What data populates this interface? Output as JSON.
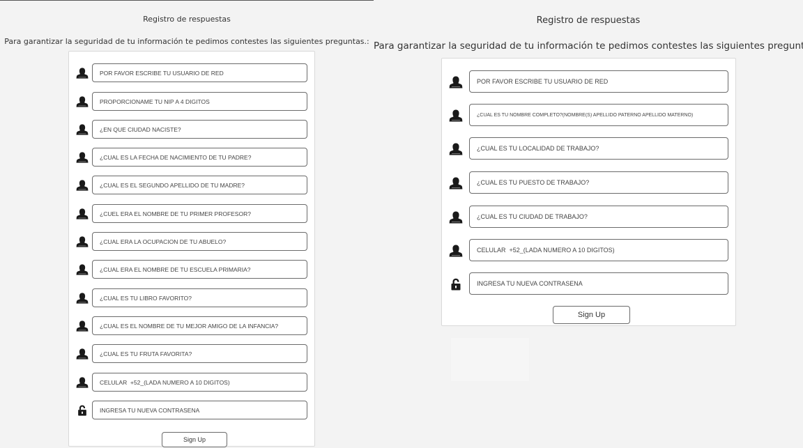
{
  "left_form": {
    "title": "Registro de respuestas",
    "subtitle": "Para garantizar la seguridad de tu información te pedimos contestes las siguientes preguntas.:",
    "fields": [
      {
        "placeholder": "POR FAVOR ESCRIBE TU USUARIO DE RED",
        "icon": "user-icon"
      },
      {
        "placeholder": "PROPORCIONAME TU NIP A 4 DIGITOS",
        "icon": "user-icon"
      },
      {
        "placeholder": "¿EN QUE CIUDAD NACISTE?",
        "icon": "user-icon"
      },
      {
        "placeholder": "¿CUAL ES LA FECHA DE NACIMIENTO DE TU PADRE?",
        "icon": "user-icon"
      },
      {
        "placeholder": "¿CUAL ES EL SEGUNDO APELLIDO DE TU MADRE?",
        "icon": "user-icon"
      },
      {
        "placeholder": "¿CUEL ERA EL NOMBRE DE TU PRIMER PROFESOR?",
        "icon": "user-icon"
      },
      {
        "placeholder": "¿CUAL ERA LA OCUPACION DE TU ABUELO?",
        "icon": "user-icon"
      },
      {
        "placeholder": "¿CUAL ERA EL NOMBRE DE TU ESCUELA PRIMARIA?",
        "icon": "user-icon"
      },
      {
        "placeholder": "¿CUAL ES TU LIBRO FAVORITO?",
        "icon": "user-icon"
      },
      {
        "placeholder": "¿CUAL ES EL NOMBRE DE TU MEJOR AMIGO DE LA INFANCIA?",
        "icon": "user-icon"
      },
      {
        "placeholder": "¿CUAL ES TU FRUTA FAVORITA?",
        "icon": "user-icon"
      },
      {
        "placeholder": "CELULAR  +52_(LADA NUMERO A 10 DIGITOS)",
        "icon": "user-icon"
      },
      {
        "placeholder": "INGRESA TU NUEVA CONTRASENA",
        "icon": "lock-icon"
      }
    ],
    "submit_label": "Sign Up"
  },
  "right_form": {
    "title": "Registro de respuestas",
    "subtitle": "Para garantizar la seguridad de tu información te pedimos contestes las siguientes preguntas.:",
    "fields": [
      {
        "placeholder": "POR FAVOR ESCRIBE TU USUARIO DE RED",
        "icon": "user-icon"
      },
      {
        "placeholder": "¿CUÁL ES TU NOMBRE COMPLETO?(NOMBRE(S) APELLIDO PATERNO APELLIDO MATERNO)",
        "icon": "user-icon"
      },
      {
        "placeholder": "¿CUAL ES TU LOCALIDAD DE TRABAJO?",
        "icon": "user-icon"
      },
      {
        "placeholder": "¿CUAL ES TU PUESTO DE TRABAJO?",
        "icon": "user-icon"
      },
      {
        "placeholder": "¿CUAL ES TU CIUDAD DE TRABAJO?",
        "icon": "user-icon"
      },
      {
        "placeholder": "CELULAR  +52_(LADA NUMERO A 10 DIGITOS)",
        "icon": "user-icon"
      },
      {
        "placeholder": "INGRESA TU NUEVA CONTRASENA",
        "icon": "lock-icon"
      }
    ],
    "submit_label": "Sign Up"
  }
}
